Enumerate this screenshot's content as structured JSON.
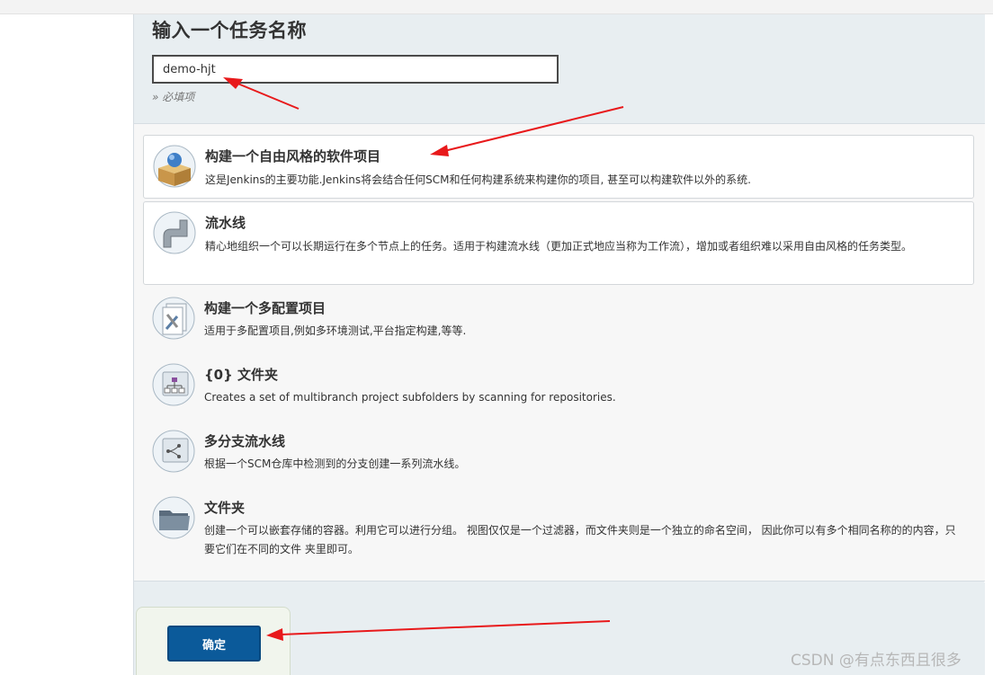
{
  "header": {
    "title": "输入一个任务名称",
    "item_name_value": "demo-hjt",
    "required_note": "» 必填项"
  },
  "job_types": [
    {
      "name": "构建一个自由风格的软件项目",
      "description": "这是Jenkins的主要功能.Jenkins将会结合任何SCM和任何构建系统来构建你的项目, 甚至可以构建软件以外的系统.",
      "icon": "freestyle-project-icon"
    },
    {
      "name": "流水线",
      "description": "精心地组织一个可以长期运行在多个节点上的任务。适用于构建流水线（更加正式地应当称为工作流），增加或者组织难以采用自由风格的任务类型。",
      "icon": "pipeline-icon"
    },
    {
      "name": "构建一个多配置项目",
      "description": "适用于多配置项目,例如多环境测试,平台指定构建,等等.",
      "icon": "multi-config-icon"
    },
    {
      "name": "{0} 文件夹",
      "description": "Creates a set of multibranch project subfolders by scanning for repositories.",
      "icon": "org-folder-icon"
    },
    {
      "name": "多分支流水线",
      "description": "根据一个SCM仓库中检测到的分支创建一系列流水线。",
      "icon": "multibranch-pipeline-icon"
    },
    {
      "name": "文件夹",
      "description": "创建一个可以嵌套存储的容器。利用它可以进行分组。 视图仅仅是一个过滤器，而文件夹则是一个独立的命名空间， 因此你可以有多个相同名称的的内容，只要它们在不同的文件 夹里即可。",
      "icon": "folder-icon"
    }
  ],
  "footer": {
    "ok_label": "确定"
  },
  "watermark": "CSDN @有点东西且很多",
  "colors": {
    "panel_bg": "#e8eef1",
    "ok_button": "#0b5a9a",
    "annotation_arrow": "#e8191b"
  }
}
